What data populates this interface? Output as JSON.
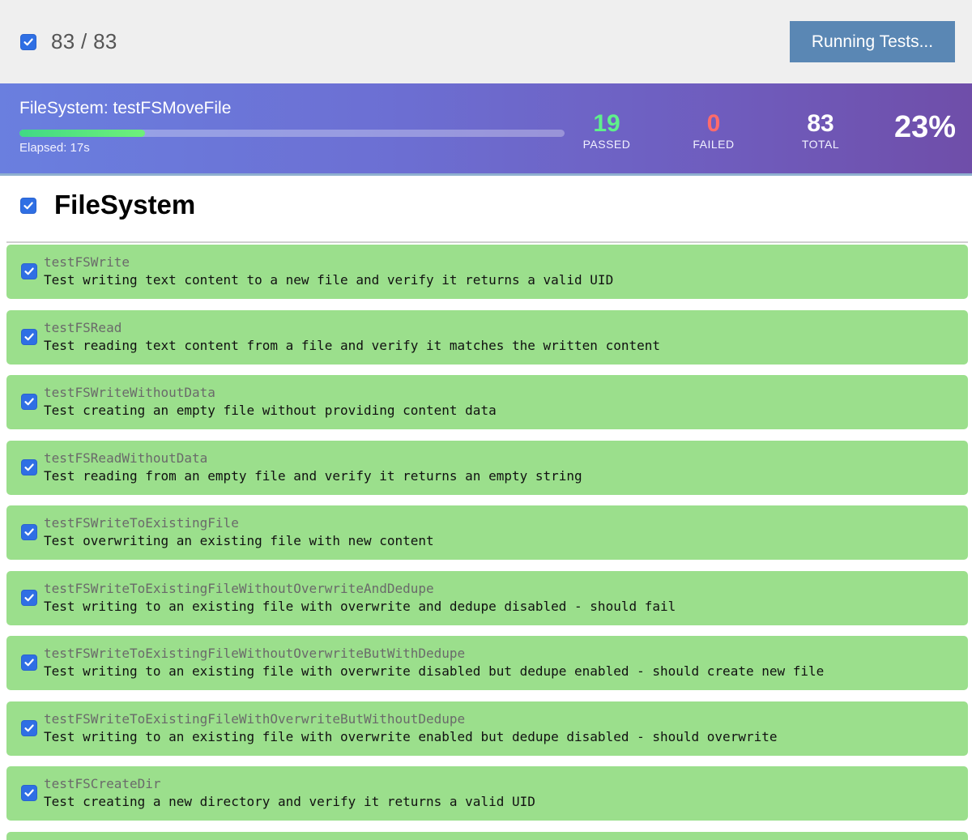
{
  "toolbar": {
    "select_all_checked": true,
    "counter": "83 / 83",
    "run_button_label": "Running Tests..."
  },
  "progress": {
    "current_test": "FileSystem: testFSMoveFile",
    "elapsed": "Elapsed: 17s",
    "percent_value": 0.23,
    "passed": "19",
    "passed_label": "PASSED",
    "failed": "0",
    "failed_label": "FAILED",
    "total": "83",
    "total_label": "TOTAL",
    "percent": "23%"
  },
  "group": {
    "title": "FileSystem",
    "checked": true
  },
  "tests": [
    {
      "name": "testFSWrite",
      "description": "Test writing text content to a new file and verify it returns a valid UID",
      "status": "passed"
    },
    {
      "name": "testFSRead",
      "description": "Test reading text content from a file and verify it matches the written content",
      "status": "passed"
    },
    {
      "name": "testFSWriteWithoutData",
      "description": "Test creating an empty file without providing content data",
      "status": "passed"
    },
    {
      "name": "testFSReadWithoutData",
      "description": "Test reading from an empty file and verify it returns an empty string",
      "status": "passed"
    },
    {
      "name": "testFSWriteToExistingFile",
      "description": "Test overwriting an existing file with new content",
      "status": "passed"
    },
    {
      "name": "testFSWriteToExistingFileWithoutOverwriteAndDedupe",
      "description": "Test writing to an existing file with overwrite and dedupe disabled - should fail",
      "status": "passed"
    },
    {
      "name": "testFSWriteToExistingFileWithoutOverwriteButWithDedupe",
      "description": "Test writing to an existing file with overwrite disabled but dedupe enabled - should create new file",
      "status": "passed"
    },
    {
      "name": "testFSWriteToExistingFileWithOverwriteButWithoutDedupe",
      "description": "Test writing to an existing file with overwrite enabled but dedupe disabled - should overwrite",
      "status": "passed"
    },
    {
      "name": "testFSCreateDir",
      "description": "Test creating a new directory and verify it returns a valid UID",
      "status": "passed"
    }
  ],
  "colors": {
    "passed_row": "#9bdf8c",
    "checkbox": "#2f6fe4",
    "run_button": "#5a87b4",
    "passed_count": "#5ff08b",
    "failed_count": "#ff6b6b"
  },
  "icons": {
    "checkbox": "checkmark-icon"
  }
}
